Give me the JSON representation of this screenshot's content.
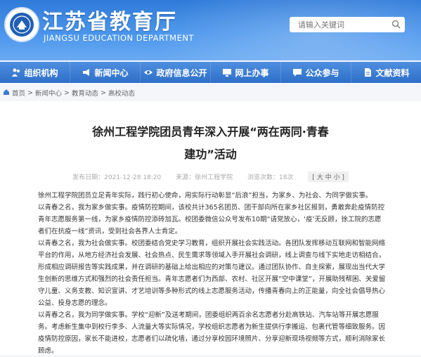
{
  "header": {
    "title": "江苏省教育厅",
    "subtitle": "JIANGSU EDUCATION DEPARTMENT",
    "search_placeholder": "请输入关键词"
  },
  "nav": {
    "items": [
      {
        "label": "组织机构",
        "icon": "group-icon"
      },
      {
        "label": "新闻中心",
        "icon": "bullhorn-icon"
      },
      {
        "label": "政府信息公开",
        "icon": "eye-icon"
      },
      {
        "label": "网上办事",
        "icon": "monitor-icon"
      },
      {
        "label": "公众参与",
        "icon": "chat-icon"
      },
      {
        "label": "文献资料",
        "icon": "document-icon"
      }
    ]
  },
  "breadcrumb": {
    "items": [
      "首页",
      "新闻中心",
      "教育动态",
      "高校动态"
    ]
  },
  "article": {
    "title_line1": "徐州工程学院团员青年深入开展“两在两同·青春",
    "title_line2": "建功”活动",
    "date": "发布日期：2021-12-28 18:20",
    "source": "来源：徐州工程学院",
    "views": "浏览次数：18次",
    "font_size_label": "[ 大 中 小 ]",
    "paragraphs": [
      "徐州工程学院团员立足青年实际，践行初心使命，用实际行动彰显“后浪”担当，为家乡、为社会、为同学做实事。",
      "以青春之名，我为家乡做实事。疫情防控期间，该校共计365名团员、团干部向所在家乡社区报到，勇敢奔赴疫情防控青年志愿服务第一线，为家乡疫情防控添砖加瓦。校团委微信公众号发布10期“请党放心，‘疫’无反顾，徐工院的志愿者们在抗疫一线”资讯，受到社会各界人士肯定。",
      "以青春之名，我为社会做实事。校团委结合党史学习教育，组织开展社会实践活动。各团队发挥移动互联网和智能网络平台的作用，从地方经济社会发展、社会热点、民生需求等领域入手开展社会调研，线上调查与线下实地走访相结合，形成相应调研报告等实践成果，并在调研的基础上给出相应的对策与建议。通过团队协作、自主探索，展现出当代大学生创新的思维方式和强烈的社会责任担当。青年志愿者们为西部、农村、社区开展“空中课堂”，开展助残帮困、关爱留守儿童、义务支教、知识宣讲、才艺培训等多种形式的线上志愿服务活动，传播青春向上的正能量，向全社会倡导热心公益、投身志愿的理念。",
      "以青春之名，我为同学做实事。学校“迎新”及送考期间，团委组织两百余名志愿者分赴高铁站、汽车站等开展志愿服务。考虑新生集中到校行李多、人流量大等实际情况，学校组织志愿者为新生提供行李搬运、包裹代管等细致服务。因疫情防控原因，家长不能进校，志愿者们以疏化墙，通过分享校园环境照片、分享迎新现场视频等方式，顺利消除家长顾虑。"
    ]
  },
  "colors": {
    "banner": "#3a86e3",
    "nav": "#2e6fc8"
  }
}
